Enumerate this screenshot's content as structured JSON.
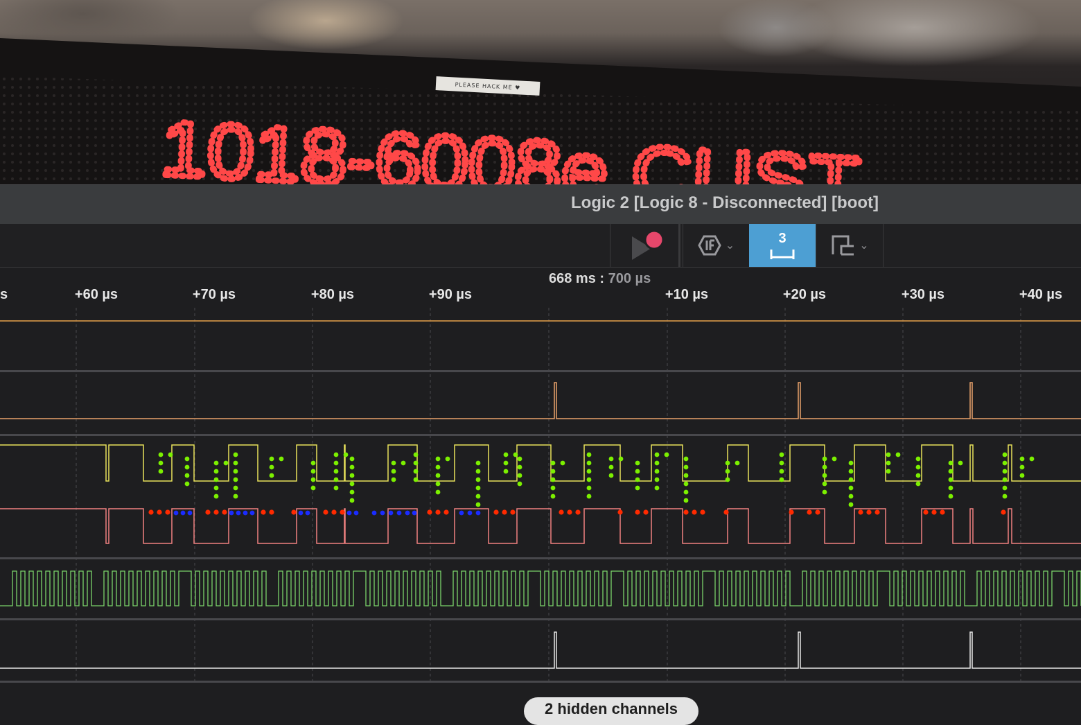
{
  "photo": {
    "sign_text": "1018-6008e CUST",
    "sticker_text": "PLEASE HACK ME ♥"
  },
  "window": {
    "title": "Logic 2 [Logic 8 - Disconnected] [boot]"
  },
  "toolbar": {
    "record_icon": "play-record-icon",
    "analyzer_icon": "analyzer-icon",
    "timing_count": "3",
    "notes_icon": "notes-icon",
    "active_color": "#4d9fd3"
  },
  "ruler": {
    "cursor_time_main": "668 ms",
    "cursor_time_sep": " : ",
    "cursor_time_sub": "700 µs",
    "ticks": [
      "s",
      "+60 µs",
      "+70 µs",
      "+80 µs",
      "+90 µs",
      "+10 µs",
      "+20 µs",
      "+30 µs",
      "+40 µs"
    ]
  },
  "channels": [
    {
      "color": "#e8a24a"
    },
    {
      "color": "#e8a26a"
    },
    {
      "color": "#e9e25a"
    },
    {
      "color": "#f08080"
    },
    {
      "color": "#7ad36a"
    },
    {
      "color": "#e6e6e6"
    }
  ],
  "overlay_colors": {
    "green": "#7cf000",
    "red": "#ff2a00",
    "blue": "#1a2cff"
  },
  "hidden_channels_label": "2 hidden channels"
}
